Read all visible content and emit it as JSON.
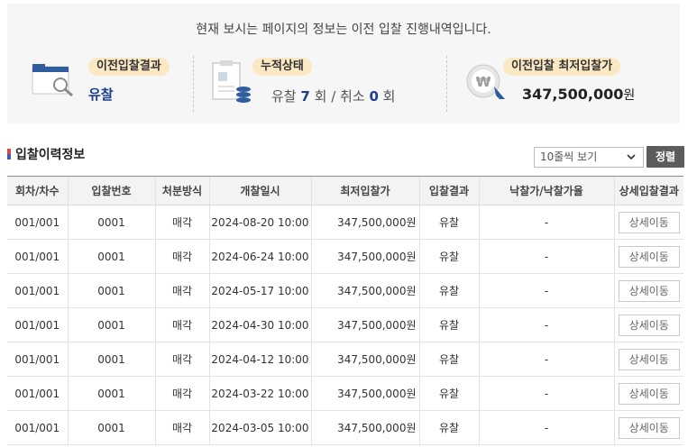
{
  "summary": {
    "notice": "현재 보시는 페이지의 정보는 이전 입찰 진행내역입니다.",
    "prev_result_label": "이전입찰결과",
    "prev_result_value": "유찰",
    "cumulative_label": "누적상태",
    "cumulative": {
      "fail_label": "유찰",
      "fail_count": "7",
      "unit1": "회",
      "sep": "/",
      "cancel_label": "취소",
      "cancel_count": "0",
      "unit2": "회"
    },
    "min_price_label": "이전입찰 최저입찰가",
    "min_price_value": "347,500,000",
    "min_price_unit": "원"
  },
  "section": {
    "title": "입찰이력정보",
    "page_size_selected": "10줄씩 보기",
    "sort_label": "정렬"
  },
  "table": {
    "columns": [
      "회차/차수",
      "입찰번호",
      "처분방식",
      "개찰일시",
      "최저입찰가",
      "입찰결과",
      "낙찰가/낙찰가율",
      "상세입찰결과"
    ],
    "rows": [
      {
        "round": "001/001",
        "bid_no": "0001",
        "method": "매각",
        "open_date": "2024-08-20 10:00",
        "min_price": "347,500,000원",
        "result": "유찰",
        "award": "-",
        "detail": "상세이동"
      },
      {
        "round": "001/001",
        "bid_no": "0001",
        "method": "매각",
        "open_date": "2024-06-24 10:00",
        "min_price": "347,500,000원",
        "result": "유찰",
        "award": "-",
        "detail": "상세이동"
      },
      {
        "round": "001/001",
        "bid_no": "0001",
        "method": "매각",
        "open_date": "2024-05-17 10:00",
        "min_price": "347,500,000원",
        "result": "유찰",
        "award": "-",
        "detail": "상세이동"
      },
      {
        "round": "001/001",
        "bid_no": "0001",
        "method": "매각",
        "open_date": "2024-04-30 10:00",
        "min_price": "347,500,000원",
        "result": "유찰",
        "award": "-",
        "detail": "상세이동"
      },
      {
        "round": "001/001",
        "bid_no": "0001",
        "method": "매각",
        "open_date": "2024-04-12 10:00",
        "min_price": "347,500,000원",
        "result": "유찰",
        "award": "-",
        "detail": "상세이동"
      },
      {
        "round": "001/001",
        "bid_no": "0001",
        "method": "매각",
        "open_date": "2024-03-22 10:00",
        "min_price": "347,500,000원",
        "result": "유찰",
        "award": "-",
        "detail": "상세이동"
      },
      {
        "round": "001/001",
        "bid_no": "0001",
        "method": "매각",
        "open_date": "2024-03-05 10:00",
        "min_price": "347,500,000원",
        "result": "유찰",
        "award": "-",
        "detail": "상세이동"
      }
    ]
  },
  "colors": {
    "accent_blue": "#1c3f8c",
    "pill_bg": "#fbe9c4",
    "summary_bg": "#f6f6f6",
    "sort_button_bg": "#5c5c5c"
  },
  "icons": {
    "prev_result": "folder-search-icon",
    "cumulative": "document-stack-icon",
    "min_price": "won-price-icon",
    "select": "chevron-down-icon"
  }
}
